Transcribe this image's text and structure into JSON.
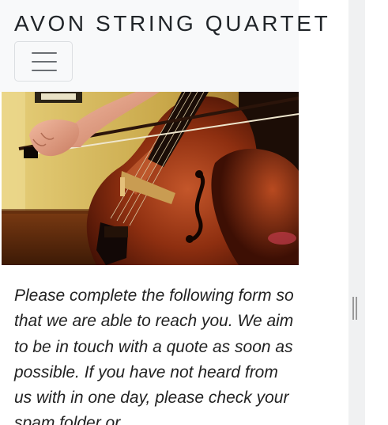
{
  "header": {
    "brand": "AVON STRING QUARTET",
    "menu_icon": "hamburger-menu-icon"
  },
  "hero": {
    "image_subject": "cello-being-played-with-bow"
  },
  "content": {
    "intro_text": "Please complete the following form so that we are able to reach you. We aim to be in touch with a quote as soon as possible. If you have not heard from us with in one day, please check your spam folder or"
  },
  "colors": {
    "navbar_bg": "#f8f9fa",
    "text": "#222222",
    "brand_text": "#212529"
  }
}
